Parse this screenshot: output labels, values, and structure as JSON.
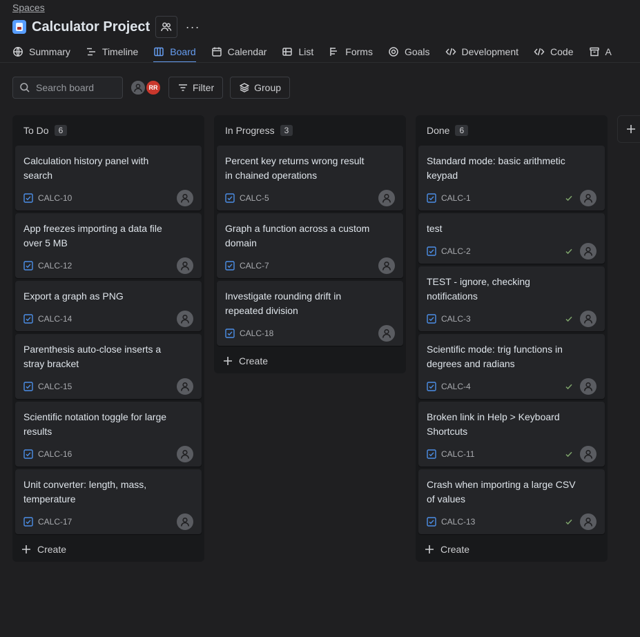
{
  "breadcrumb": "Spaces",
  "project": {
    "title": "Calculator Project",
    "more_label": "···"
  },
  "tabs": [
    {
      "label": "Summary",
      "icon": "globe-icon"
    },
    {
      "label": "Timeline",
      "icon": "timeline-icon"
    },
    {
      "label": "Board",
      "icon": "board-icon",
      "active": true
    },
    {
      "label": "Calendar",
      "icon": "calendar-icon"
    },
    {
      "label": "List",
      "icon": "list-icon"
    },
    {
      "label": "Forms",
      "icon": "forms-icon"
    },
    {
      "label": "Goals",
      "icon": "goals-icon"
    },
    {
      "label": "Development",
      "icon": "code-brackets-icon"
    },
    {
      "label": "Code",
      "icon": "code-brackets-icon"
    },
    {
      "label": "A",
      "icon": "archive-icon"
    }
  ],
  "toolbar": {
    "search_placeholder": "Search board",
    "avatar_initials": "RR",
    "filter_label": "Filter",
    "group_label": "Group"
  },
  "columns": [
    {
      "name": "To Do",
      "count": "6",
      "cards": [
        {
          "title": "Calculation history panel with search",
          "key": "CALC-10",
          "done": false
        },
        {
          "title": "App freezes importing a data file over 5 MB",
          "key": "CALC-12",
          "done": false
        },
        {
          "title": "Export a graph as PNG",
          "key": "CALC-14",
          "done": false
        },
        {
          "title": "Parenthesis auto-close inserts a stray bracket",
          "key": "CALC-15",
          "done": false
        },
        {
          "title": "Scientific notation toggle for large results",
          "key": "CALC-16",
          "done": false
        },
        {
          "title": "Unit converter: length, mass, temperature",
          "key": "CALC-17",
          "done": false
        }
      ]
    },
    {
      "name": "In Progress",
      "count": "3",
      "cards": [
        {
          "title": "Percent key returns wrong result in chained operations",
          "key": "CALC-5",
          "done": false
        },
        {
          "title": "Graph a function across a custom domain",
          "key": "CALC-7",
          "done": false
        },
        {
          "title": "Investigate rounding drift in repeated division",
          "key": "CALC-18",
          "done": false
        }
      ]
    },
    {
      "name": "Done",
      "count": "6",
      "cards": [
        {
          "title": "Standard mode: basic arithmetic keypad",
          "key": "CALC-1",
          "done": true
        },
        {
          "title": "test",
          "key": "CALC-2",
          "done": true
        },
        {
          "title": "TEST - ignore, checking notifications",
          "key": "CALC-3",
          "done": true
        },
        {
          "title": "Scientific mode: trig functions in degrees and radians",
          "key": "CALC-4",
          "done": true
        },
        {
          "title": "Broken link in Help > Keyboard Shortcuts",
          "key": "CALC-11",
          "done": true
        },
        {
          "title": "Crash when importing a large CSV of values",
          "key": "CALC-13",
          "done": true
        }
      ]
    }
  ],
  "create_label": "Create",
  "colors": {
    "accent": "#669df1",
    "task_icon": "#4c8fe8",
    "done_check": "#7ea46b"
  }
}
